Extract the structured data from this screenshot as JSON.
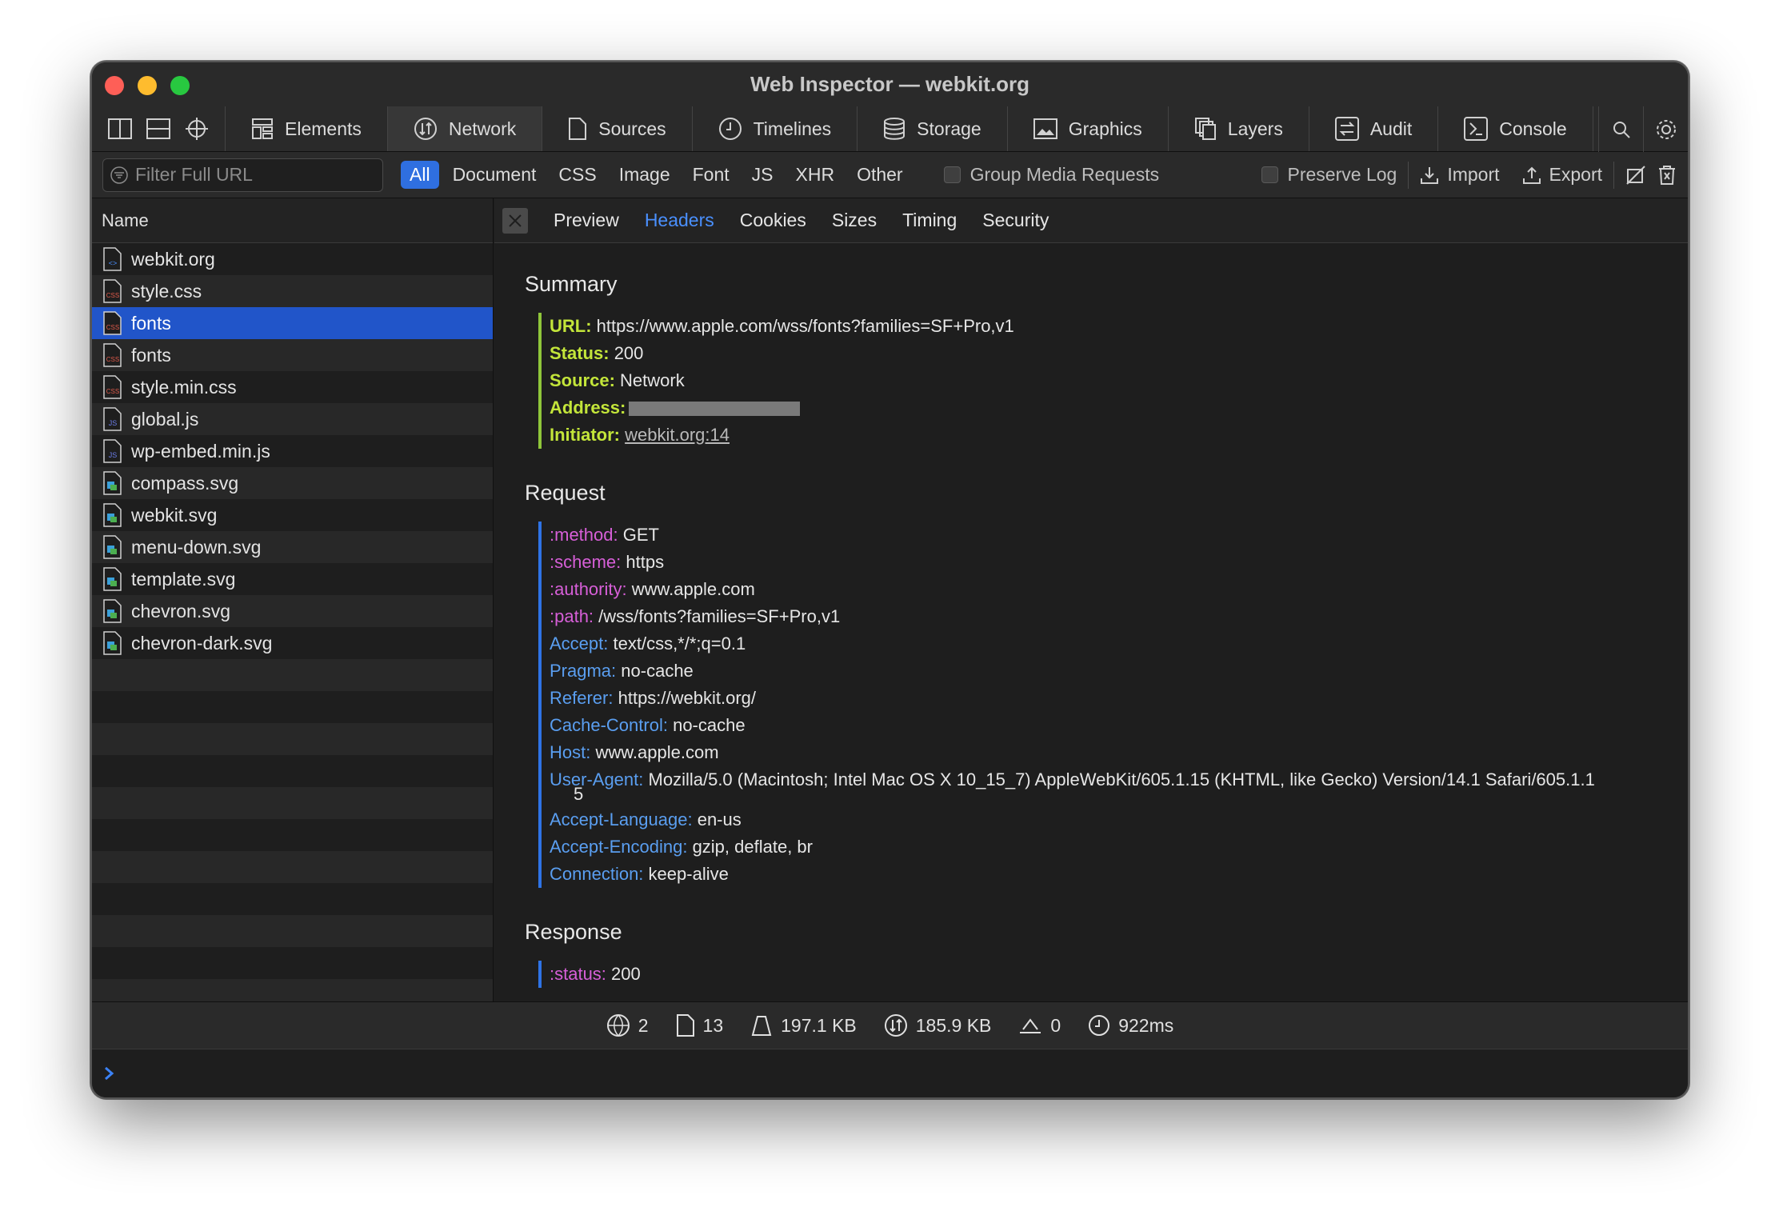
{
  "window": {
    "title": "Web Inspector — webkit.org"
  },
  "tabs": [
    {
      "label": "Elements",
      "icon": "elements-icon"
    },
    {
      "label": "Network",
      "icon": "network-icon",
      "active": true
    },
    {
      "label": "Sources",
      "icon": "sources-icon"
    },
    {
      "label": "Timelines",
      "icon": "timelines-icon"
    },
    {
      "label": "Storage",
      "icon": "storage-icon"
    },
    {
      "label": "Graphics",
      "icon": "graphics-icon"
    },
    {
      "label": "Layers",
      "icon": "layers-icon"
    },
    {
      "label": "Audit",
      "icon": "audit-icon"
    },
    {
      "label": "Console",
      "icon": "console-icon"
    }
  ],
  "filter": {
    "placeholder": "Filter Full URL",
    "types": [
      "All",
      "Document",
      "CSS",
      "Image",
      "Font",
      "JS",
      "XHR",
      "Other"
    ],
    "active_type": "All",
    "group_media": "Group Media Requests",
    "preserve_log": "Preserve Log",
    "import": "Import",
    "export": "Export"
  },
  "list": {
    "header": "Name",
    "items": [
      {
        "name": "webkit.org",
        "kind": "doc"
      },
      {
        "name": "style.css",
        "kind": "css"
      },
      {
        "name": "fonts",
        "kind": "css",
        "selected": true
      },
      {
        "name": "fonts",
        "kind": "css"
      },
      {
        "name": "style.min.css",
        "kind": "css"
      },
      {
        "name": "global.js",
        "kind": "js"
      },
      {
        "name": "wp-embed.min.js",
        "kind": "js"
      },
      {
        "name": "compass.svg",
        "kind": "img"
      },
      {
        "name": "webkit.svg",
        "kind": "img"
      },
      {
        "name": "menu-down.svg",
        "kind": "img"
      },
      {
        "name": "template.svg",
        "kind": "img"
      },
      {
        "name": "chevron.svg",
        "kind": "img"
      },
      {
        "name": "chevron-dark.svg",
        "kind": "img"
      }
    ]
  },
  "detail_tabs": [
    "Preview",
    "Headers",
    "Cookies",
    "Sizes",
    "Timing",
    "Security"
  ],
  "detail_active": "Headers",
  "summary": {
    "title": "Summary",
    "url_k": "URL:",
    "url_v": "https://www.apple.com/wss/fonts?families=SF+Pro,v1",
    "status_k": "Status:",
    "status_v": "200",
    "source_k": "Source:",
    "source_v": "Network",
    "address_k": "Address:",
    "initiator_k": "Initiator:",
    "initiator_v": "webkit.org:14"
  },
  "request": {
    "title": "Request",
    "headers": [
      {
        "k": ":method:",
        "v": "GET",
        "pseudo": true
      },
      {
        "k": ":scheme:",
        "v": "https",
        "pseudo": true
      },
      {
        "k": ":authority:",
        "v": "www.apple.com",
        "pseudo": true
      },
      {
        "k": ":path:",
        "v": "/wss/fonts?families=SF+Pro,v1",
        "pseudo": true
      },
      {
        "k": "Accept:",
        "v": "text/css,*/*;q=0.1"
      },
      {
        "k": "Pragma:",
        "v": "no-cache"
      },
      {
        "k": "Referer:",
        "v": "https://webkit.org/"
      },
      {
        "k": "Cache-Control:",
        "v": "no-cache"
      },
      {
        "k": "Host:",
        "v": "www.apple.com"
      },
      {
        "k": "User-Agent:",
        "v": "Mozilla/5.0 (Macintosh; Intel Mac OS X 10_15_7) AppleWebKit/605.1.15 (KHTML, like Gecko) Version/14.1 Safari/605.1.1",
        "cont": "5"
      },
      {
        "k": "Accept-Language:",
        "v": "en-us"
      },
      {
        "k": "Accept-Encoding:",
        "v": "gzip, deflate, br"
      },
      {
        "k": "Connection:",
        "v": "keep-alive"
      }
    ]
  },
  "response": {
    "title": "Response",
    "status_k": ":status:",
    "status_v": "200"
  },
  "status": {
    "domains": "2",
    "resources": "13",
    "transferred": "197.1 KB",
    "size": "185.9 KB",
    "redirects": "0",
    "time": "922ms"
  },
  "colors": {
    "accent": "#2f6fe0",
    "selected_row": "#2155c9",
    "summary_key": "#c3e53a",
    "pseudo_key": "#d75fd8",
    "header_key": "#5a9ef0"
  }
}
